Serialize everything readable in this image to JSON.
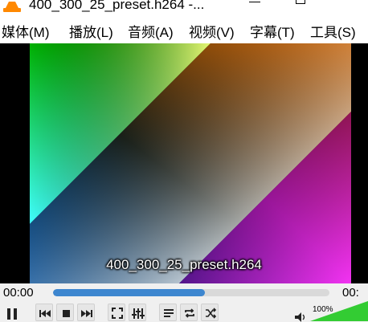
{
  "window": {
    "title": "400_300_25_preset.h264 -..."
  },
  "menu": {
    "items": [
      "媒体(M)",
      "播放(L)",
      "音频(A)",
      "视频(V)",
      "字幕(T)",
      "工具(S)"
    ]
  },
  "video": {
    "subtitle": "400_300_25_preset.h264"
  },
  "playback": {
    "time_elapsed": "00:00",
    "time_total": "00:",
    "progress_fraction": 0.55
  },
  "volume": {
    "label": "100%",
    "level_fraction": 1.0
  },
  "controls": {
    "icons": [
      "pause-icon",
      "previous-icon",
      "stop-icon",
      "next-icon",
      "fullscreen-icon",
      "equalizer-icon",
      "playlist-icon",
      "loop-icon",
      "shuffle-icon",
      "speaker-icon"
    ]
  },
  "colors": {
    "seek_fill": "#3d86cf",
    "volume_fill": "#33cc33"
  }
}
